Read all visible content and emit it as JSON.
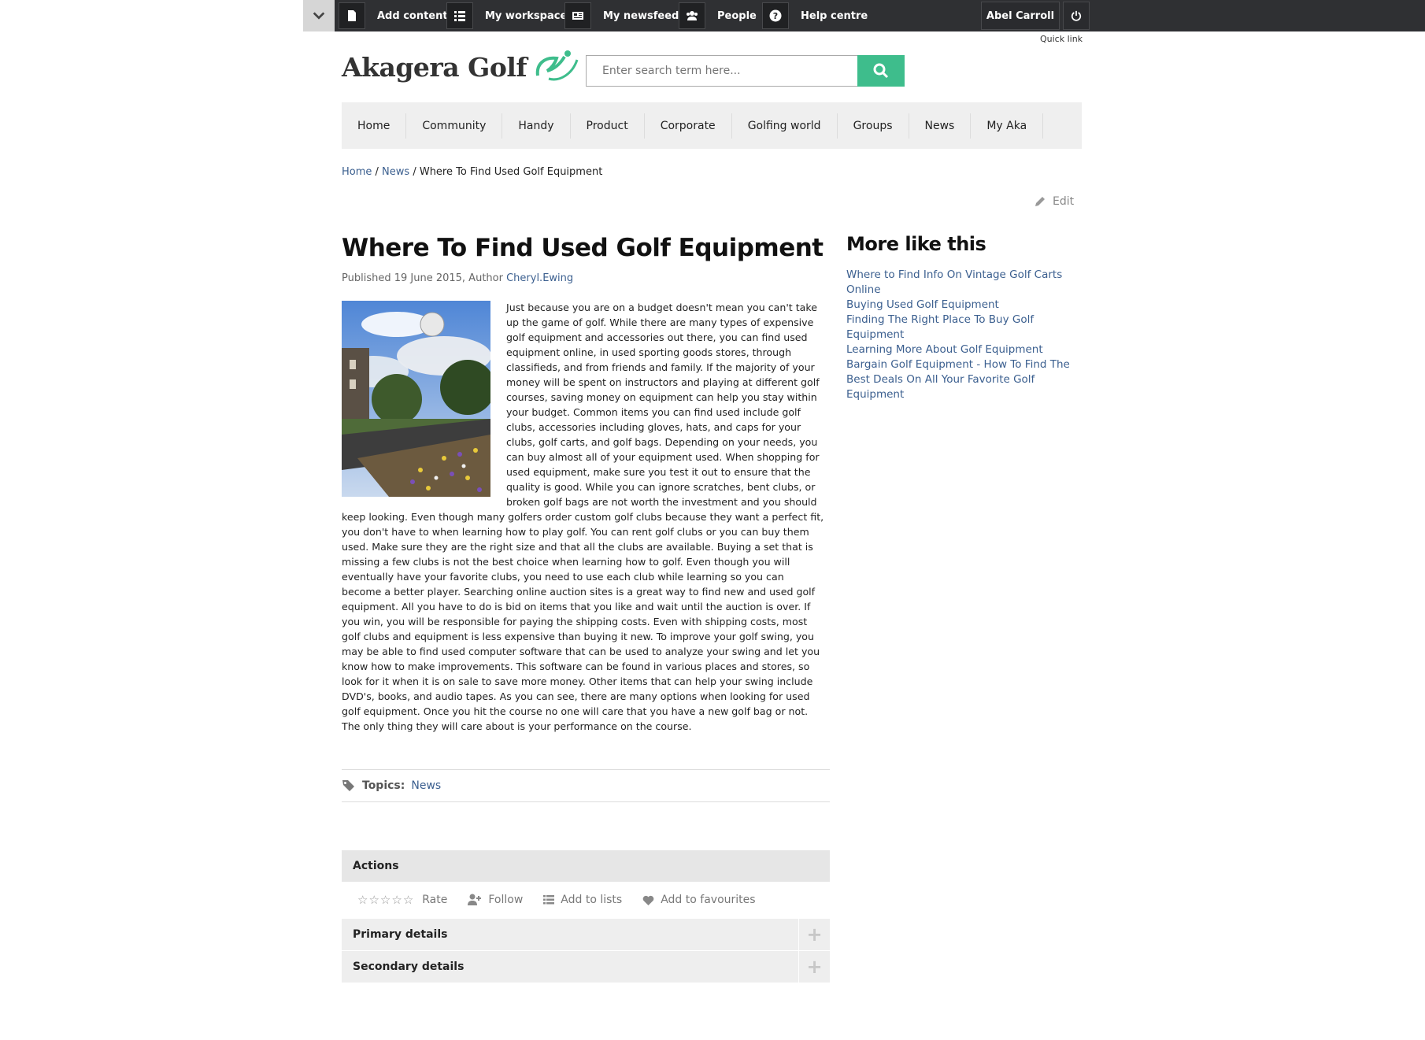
{
  "topbar": {
    "items": [
      {
        "label": "Add content",
        "icon": "document-icon"
      },
      {
        "label": "My workspace",
        "icon": "list-icon"
      },
      {
        "label": "My newsfeed",
        "icon": "newspaper-icon"
      },
      {
        "label": "People",
        "icon": "people-icon"
      },
      {
        "label": "Help centre",
        "icon": "question-icon"
      }
    ],
    "user_name": "Abel Carroll",
    "quick_link": "Quick link"
  },
  "header": {
    "logo_text": "Akagera Golf",
    "search_placeholder": "Enter search term here..."
  },
  "nav": {
    "items": [
      "Home",
      "Community",
      "Handy",
      "Product",
      "Corporate",
      "Golfing world",
      "Groups",
      "News",
      "My Aka"
    ]
  },
  "breadcrumb": {
    "home": "Home",
    "sep1": " / ",
    "news": "News",
    "sep2": " / ",
    "current": "Where To Find Used Golf Equipment"
  },
  "edit_label": "Edit",
  "article": {
    "title": "Where To Find Used Golf Equipment",
    "published": "Published 19 June 2015, Author ",
    "author": "Cheryl.Ewing",
    "body": "Just because you are on a budget doesn't mean you can't take up the game of golf. While there are many types of expensive golf equipment and accessories out there, you can find used equipment online, in used sporting goods stores, through classifieds, and from friends and family. If the majority of your money will be spent on instructors and playing at different golf courses, saving money on equipment can help you stay within your budget. Common items you can find used include golf clubs, accessories including gloves, hats, and caps for your clubs, golf carts, and golf bags. Depending on your needs, you can buy almost all of your equipment used. When shopping for used equipment, make sure you test it out to ensure that the quality is good. While you can ignore scratches, bent clubs, or broken golf bags are not worth the investment and you should keep looking. Even though many golfers order custom golf clubs because they want a perfect fit, you don't have to when learning how to play golf. You can rent golf clubs or you can buy them used. Make sure they are the right size and that all the clubs are available. Buying a set that is missing a few clubs is not the best choice when learning how to golf. Even though you will eventually have your favorite clubs, you need to use each club while learning so you can become a better player. Searching online auction sites is a great way to find new and used golf equipment. All you have to do is bid on items that you like and wait until the auction is over. If you win, you will be responsible for paying the shipping costs. Even with shipping costs, most golf clubs and equipment is less expensive than buying it new. To improve your golf swing, you may be able to find used computer software that can be used to analyze your swing and let you know how to make improvements. This software can be found in various places and stores, so look for it when it is on sale to save more money. Other items that can help your swing include DVD's, books, and audio tapes. As you can see, there are many options when looking for used golf equipment. Once you hit the course no one will care that you have a new golf bag or not. The only thing they will care about is your performance on the course.",
    "topics_label": "Topics:",
    "topic": "News"
  },
  "actions": {
    "title": "Actions",
    "rate": "Rate",
    "follow": "Follow",
    "add_to_lists": "Add to lists",
    "add_to_favourites": "Add to favourites",
    "primary_details": "Primary details",
    "secondary_details": "Secondary details",
    "expand": "+"
  },
  "sidebar": {
    "title": "More like this",
    "links": [
      "Where to Find Info On Vintage Golf Carts Online",
      "Buying Used Golf Equipment",
      "Finding The Right Place To Buy Golf Equipment",
      "Learning More About Golf Equipment",
      "Bargain Golf Equipment - How To Find The Best Deals On All Your Favorite Golf Equipment"
    ]
  },
  "colors": {
    "topbar": "#2f3033",
    "accent_green": "#3ebd8c",
    "link": "#3b5f8f"
  }
}
